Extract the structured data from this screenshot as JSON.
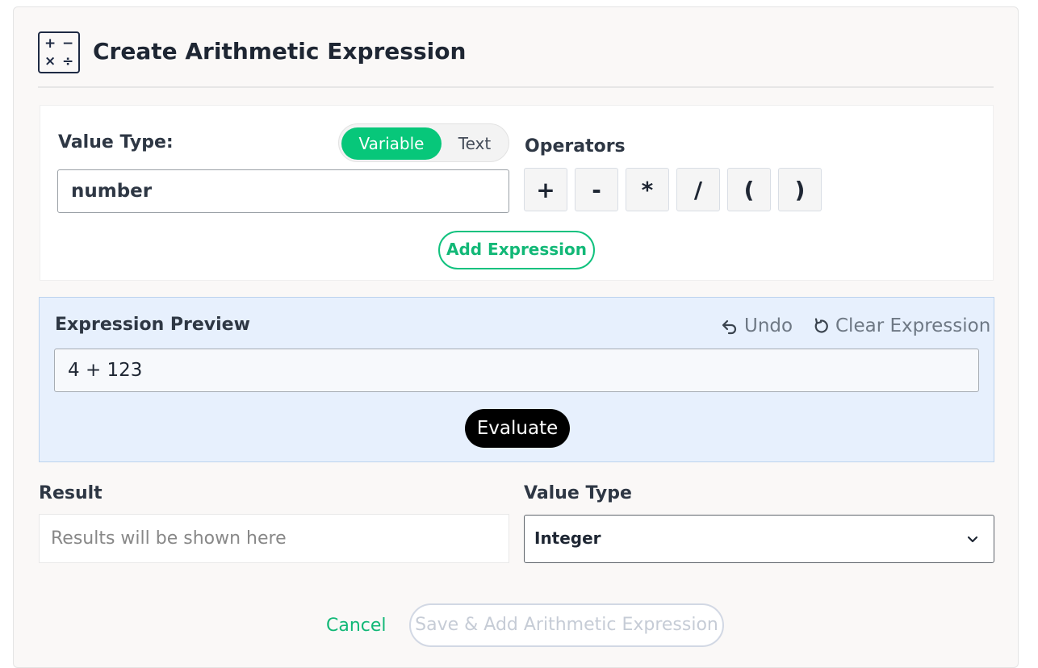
{
  "header": {
    "icon_symbols": {
      "plus": "+",
      "minus": "−",
      "times": "×",
      "divide": "÷"
    },
    "title": "Create Arithmetic Expression"
  },
  "value_panel": {
    "label": "Value Type:",
    "toggle": {
      "active": "Variable",
      "inactive": "Text"
    },
    "input_value": "number",
    "operators_label": "Operators",
    "operators": [
      "+",
      "-",
      "*",
      "/",
      "(",
      ")"
    ],
    "add_expression_label": "Add Expression"
  },
  "preview_panel": {
    "label": "Expression Preview",
    "undo_label": "Undo",
    "clear_label": "Clear Expression",
    "expression": "4 + 123",
    "evaluate_label": "Evaluate"
  },
  "result": {
    "label": "Result",
    "placeholder": "Results will be shown here",
    "value_type_label": "Value Type",
    "value_type_selected": "Integer"
  },
  "footer": {
    "cancel_label": "Cancel",
    "save_label": "Save & Add Arithmetic Expression"
  },
  "colors": {
    "accent_green": "#07c77a",
    "preview_bg": "#e7f0fd",
    "evaluate_bg": "#000000"
  }
}
